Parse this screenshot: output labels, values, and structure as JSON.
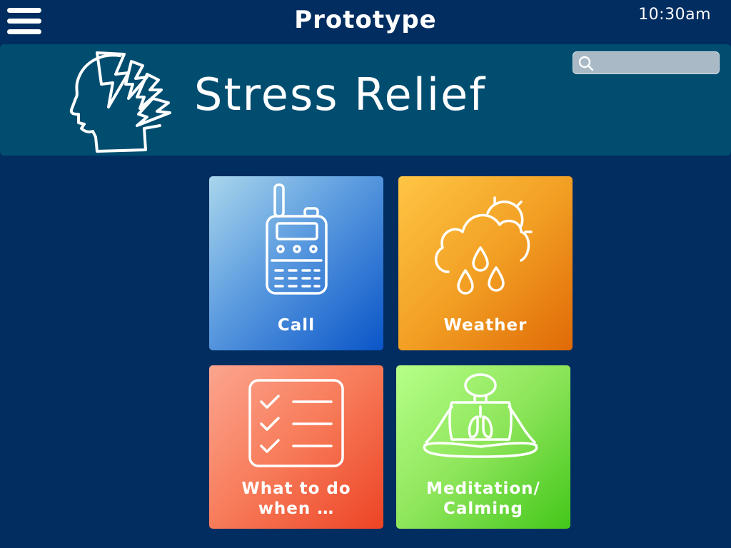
{
  "topbar": {
    "title": "Prototype",
    "time": "10:30am"
  },
  "header": {
    "title": "Stress Relief",
    "search_placeholder": "",
    "search_value": ""
  },
  "tiles": [
    {
      "label": "Call",
      "icon": "walkie-talkie-icon"
    },
    {
      "label": "Weather",
      "icon": "rain-cloud-sun-icon"
    },
    {
      "label_lines": [
        "What to do",
        "when …"
      ],
      "icon": "checklist-icon"
    },
    {
      "label_lines": [
        "Meditation/",
        "Calming"
      ],
      "icon": "meditation-person-icon"
    }
  ],
  "colors": {
    "background": "#012d60",
    "header_band": "#014d70",
    "call_tile": "#3d82d8",
    "weather_tile": "#f09a20",
    "what_to_do_tile": "#f36a4a",
    "meditation_tile": "#7fdd4c"
  }
}
